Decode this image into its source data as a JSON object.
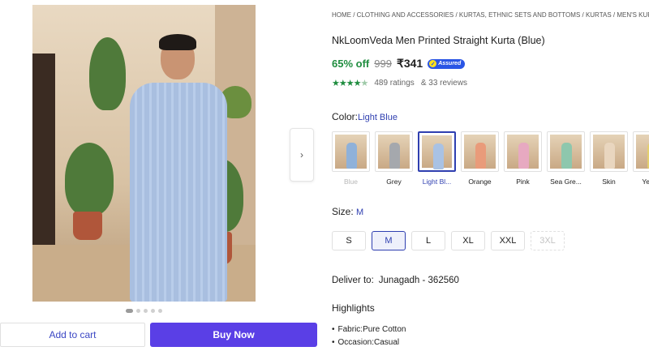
{
  "gallery": {
    "next_arrow": "›",
    "dots": [
      true,
      false,
      false,
      false,
      false
    ],
    "add_to_cart_label": "Add to cart",
    "buy_now_label": "Buy Now"
  },
  "product": {
    "breadcrumb": "HOME / CLOTHING AND ACCESSORIES / KURTAS, ETHNIC SETS AND BOTTOMS / KURTAS / MEN'S KURTAS / NkLoomVeda Men Printed Straight Kurta",
    "title": "NkLoomVeda Men Printed Straight Kurta  (Blue)",
    "discount": "65% off",
    "mrp": "999",
    "price": "₹341",
    "assured_label": "Assured",
    "rating_value": 4.5,
    "ratings": "489 ratings",
    "reviews": "& 33 reviews"
  },
  "color": {
    "label": "Color:",
    "selected": "Light Blue",
    "options": [
      {
        "label": "Blue",
        "color": "#8fb1d9",
        "state": "disabled"
      },
      {
        "label": "Grey",
        "color": "#a5a8ad",
        "state": "normal"
      },
      {
        "label": "Light Bl...",
        "color": "#a9c2e4",
        "state": "selected"
      },
      {
        "label": "Orange",
        "color": "#e99b7a",
        "state": "normal"
      },
      {
        "label": "Pink",
        "color": "#e7a9c1",
        "state": "normal"
      },
      {
        "label": "Sea Gre...",
        "color": "#8ec7ad",
        "state": "normal"
      },
      {
        "label": "Skin",
        "color": "#e9d6bf",
        "state": "normal"
      },
      {
        "label": "Yellow",
        "color": "#e4cf6f",
        "state": "normal"
      }
    ]
  },
  "size": {
    "label": "Size:",
    "selected": "M",
    "options": [
      {
        "label": "S",
        "state": "normal"
      },
      {
        "label": "M",
        "state": "selected"
      },
      {
        "label": "L",
        "state": "normal"
      },
      {
        "label": "XL",
        "state": "normal"
      },
      {
        "label": "XXL",
        "state": "normal"
      },
      {
        "label": "3XL",
        "state": "disabled"
      }
    ]
  },
  "delivery": {
    "label": "Deliver to:",
    "location": "Junagadh - 362560"
  },
  "highlights": {
    "title": "Highlights",
    "items": [
      "Fabric:Pure Cotton",
      "Occasion:Casual"
    ]
  }
}
